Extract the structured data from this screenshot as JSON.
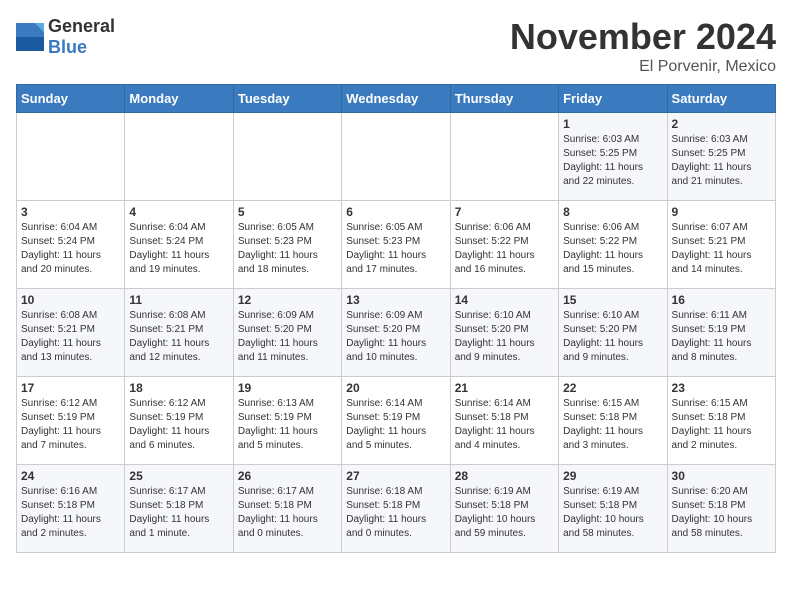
{
  "logo": {
    "general": "General",
    "blue": "Blue"
  },
  "header": {
    "month": "November 2024",
    "location": "El Porvenir, Mexico"
  },
  "weekdays": [
    "Sunday",
    "Monday",
    "Tuesday",
    "Wednesday",
    "Thursday",
    "Friday",
    "Saturday"
  ],
  "weeks": [
    [
      {
        "day": "",
        "info": ""
      },
      {
        "day": "",
        "info": ""
      },
      {
        "day": "",
        "info": ""
      },
      {
        "day": "",
        "info": ""
      },
      {
        "day": "",
        "info": ""
      },
      {
        "day": "1",
        "info": "Sunrise: 6:03 AM\nSunset: 5:25 PM\nDaylight: 11 hours\nand 22 minutes."
      },
      {
        "day": "2",
        "info": "Sunrise: 6:03 AM\nSunset: 5:25 PM\nDaylight: 11 hours\nand 21 minutes."
      }
    ],
    [
      {
        "day": "3",
        "info": "Sunrise: 6:04 AM\nSunset: 5:24 PM\nDaylight: 11 hours\nand 20 minutes."
      },
      {
        "day": "4",
        "info": "Sunrise: 6:04 AM\nSunset: 5:24 PM\nDaylight: 11 hours\nand 19 minutes."
      },
      {
        "day": "5",
        "info": "Sunrise: 6:05 AM\nSunset: 5:23 PM\nDaylight: 11 hours\nand 18 minutes."
      },
      {
        "day": "6",
        "info": "Sunrise: 6:05 AM\nSunset: 5:23 PM\nDaylight: 11 hours\nand 17 minutes."
      },
      {
        "day": "7",
        "info": "Sunrise: 6:06 AM\nSunset: 5:22 PM\nDaylight: 11 hours\nand 16 minutes."
      },
      {
        "day": "8",
        "info": "Sunrise: 6:06 AM\nSunset: 5:22 PM\nDaylight: 11 hours\nand 15 minutes."
      },
      {
        "day": "9",
        "info": "Sunrise: 6:07 AM\nSunset: 5:21 PM\nDaylight: 11 hours\nand 14 minutes."
      }
    ],
    [
      {
        "day": "10",
        "info": "Sunrise: 6:08 AM\nSunset: 5:21 PM\nDaylight: 11 hours\nand 13 minutes."
      },
      {
        "day": "11",
        "info": "Sunrise: 6:08 AM\nSunset: 5:21 PM\nDaylight: 11 hours\nand 12 minutes."
      },
      {
        "day": "12",
        "info": "Sunrise: 6:09 AM\nSunset: 5:20 PM\nDaylight: 11 hours\nand 11 minutes."
      },
      {
        "day": "13",
        "info": "Sunrise: 6:09 AM\nSunset: 5:20 PM\nDaylight: 11 hours\nand 10 minutes."
      },
      {
        "day": "14",
        "info": "Sunrise: 6:10 AM\nSunset: 5:20 PM\nDaylight: 11 hours\nand 9 minutes."
      },
      {
        "day": "15",
        "info": "Sunrise: 6:10 AM\nSunset: 5:20 PM\nDaylight: 11 hours\nand 9 minutes."
      },
      {
        "day": "16",
        "info": "Sunrise: 6:11 AM\nSunset: 5:19 PM\nDaylight: 11 hours\nand 8 minutes."
      }
    ],
    [
      {
        "day": "17",
        "info": "Sunrise: 6:12 AM\nSunset: 5:19 PM\nDaylight: 11 hours\nand 7 minutes."
      },
      {
        "day": "18",
        "info": "Sunrise: 6:12 AM\nSunset: 5:19 PM\nDaylight: 11 hours\nand 6 minutes."
      },
      {
        "day": "19",
        "info": "Sunrise: 6:13 AM\nSunset: 5:19 PM\nDaylight: 11 hours\nand 5 minutes."
      },
      {
        "day": "20",
        "info": "Sunrise: 6:14 AM\nSunset: 5:19 PM\nDaylight: 11 hours\nand 5 minutes."
      },
      {
        "day": "21",
        "info": "Sunrise: 6:14 AM\nSunset: 5:18 PM\nDaylight: 11 hours\nand 4 minutes."
      },
      {
        "day": "22",
        "info": "Sunrise: 6:15 AM\nSunset: 5:18 PM\nDaylight: 11 hours\nand 3 minutes."
      },
      {
        "day": "23",
        "info": "Sunrise: 6:15 AM\nSunset: 5:18 PM\nDaylight: 11 hours\nand 2 minutes."
      }
    ],
    [
      {
        "day": "24",
        "info": "Sunrise: 6:16 AM\nSunset: 5:18 PM\nDaylight: 11 hours\nand 2 minutes."
      },
      {
        "day": "25",
        "info": "Sunrise: 6:17 AM\nSunset: 5:18 PM\nDaylight: 11 hours\nand 1 minute."
      },
      {
        "day": "26",
        "info": "Sunrise: 6:17 AM\nSunset: 5:18 PM\nDaylight: 11 hours\nand 0 minutes."
      },
      {
        "day": "27",
        "info": "Sunrise: 6:18 AM\nSunset: 5:18 PM\nDaylight: 11 hours\nand 0 minutes."
      },
      {
        "day": "28",
        "info": "Sunrise: 6:19 AM\nSunset: 5:18 PM\nDaylight: 10 hours\nand 59 minutes."
      },
      {
        "day": "29",
        "info": "Sunrise: 6:19 AM\nSunset: 5:18 PM\nDaylight: 10 hours\nand 58 minutes."
      },
      {
        "day": "30",
        "info": "Sunrise: 6:20 AM\nSunset: 5:18 PM\nDaylight: 10 hours\nand 58 minutes."
      }
    ]
  ]
}
